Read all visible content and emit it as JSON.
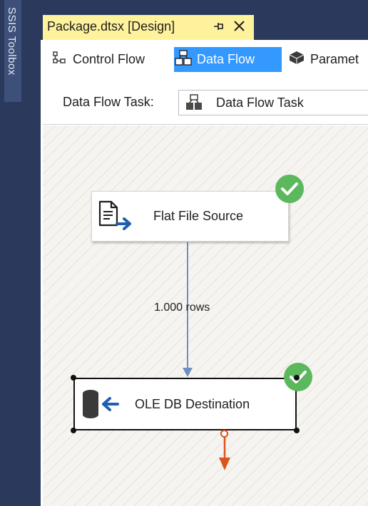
{
  "toolbox": {
    "label": "SSIS Toolbox"
  },
  "document_tab": {
    "title": "Package.dtsx [Design]",
    "pin_icon": "pin-icon",
    "close_icon": "close-icon"
  },
  "designer_tabs": [
    {
      "label": "Control Flow",
      "icon": "control-flow-icon",
      "selected": false
    },
    {
      "label": "Data Flow",
      "icon": "data-flow-icon",
      "selected": true
    },
    {
      "label": "Paramet",
      "icon": "parameters-icon",
      "selected": false
    }
  ],
  "task_selector": {
    "label": "Data Flow Task:",
    "value": "Data Flow Task",
    "icon": "data-flow-task-icon"
  },
  "canvas": {
    "source": {
      "label": "Flat File Source",
      "icon": "flat-file-source-icon",
      "status": "success"
    },
    "path": {
      "label": "1.000 rows"
    },
    "destination": {
      "label": "OLE DB Destination",
      "icon": "ole-db-destination-icon",
      "status": "success",
      "selected": true
    }
  },
  "colors": {
    "accent": "#3399ff",
    "tab_bg": "#fff29d",
    "frame": "#2b3a5c",
    "success": "#5cb85c",
    "error_output": "#d9541e",
    "path": "#6f8fbf"
  }
}
